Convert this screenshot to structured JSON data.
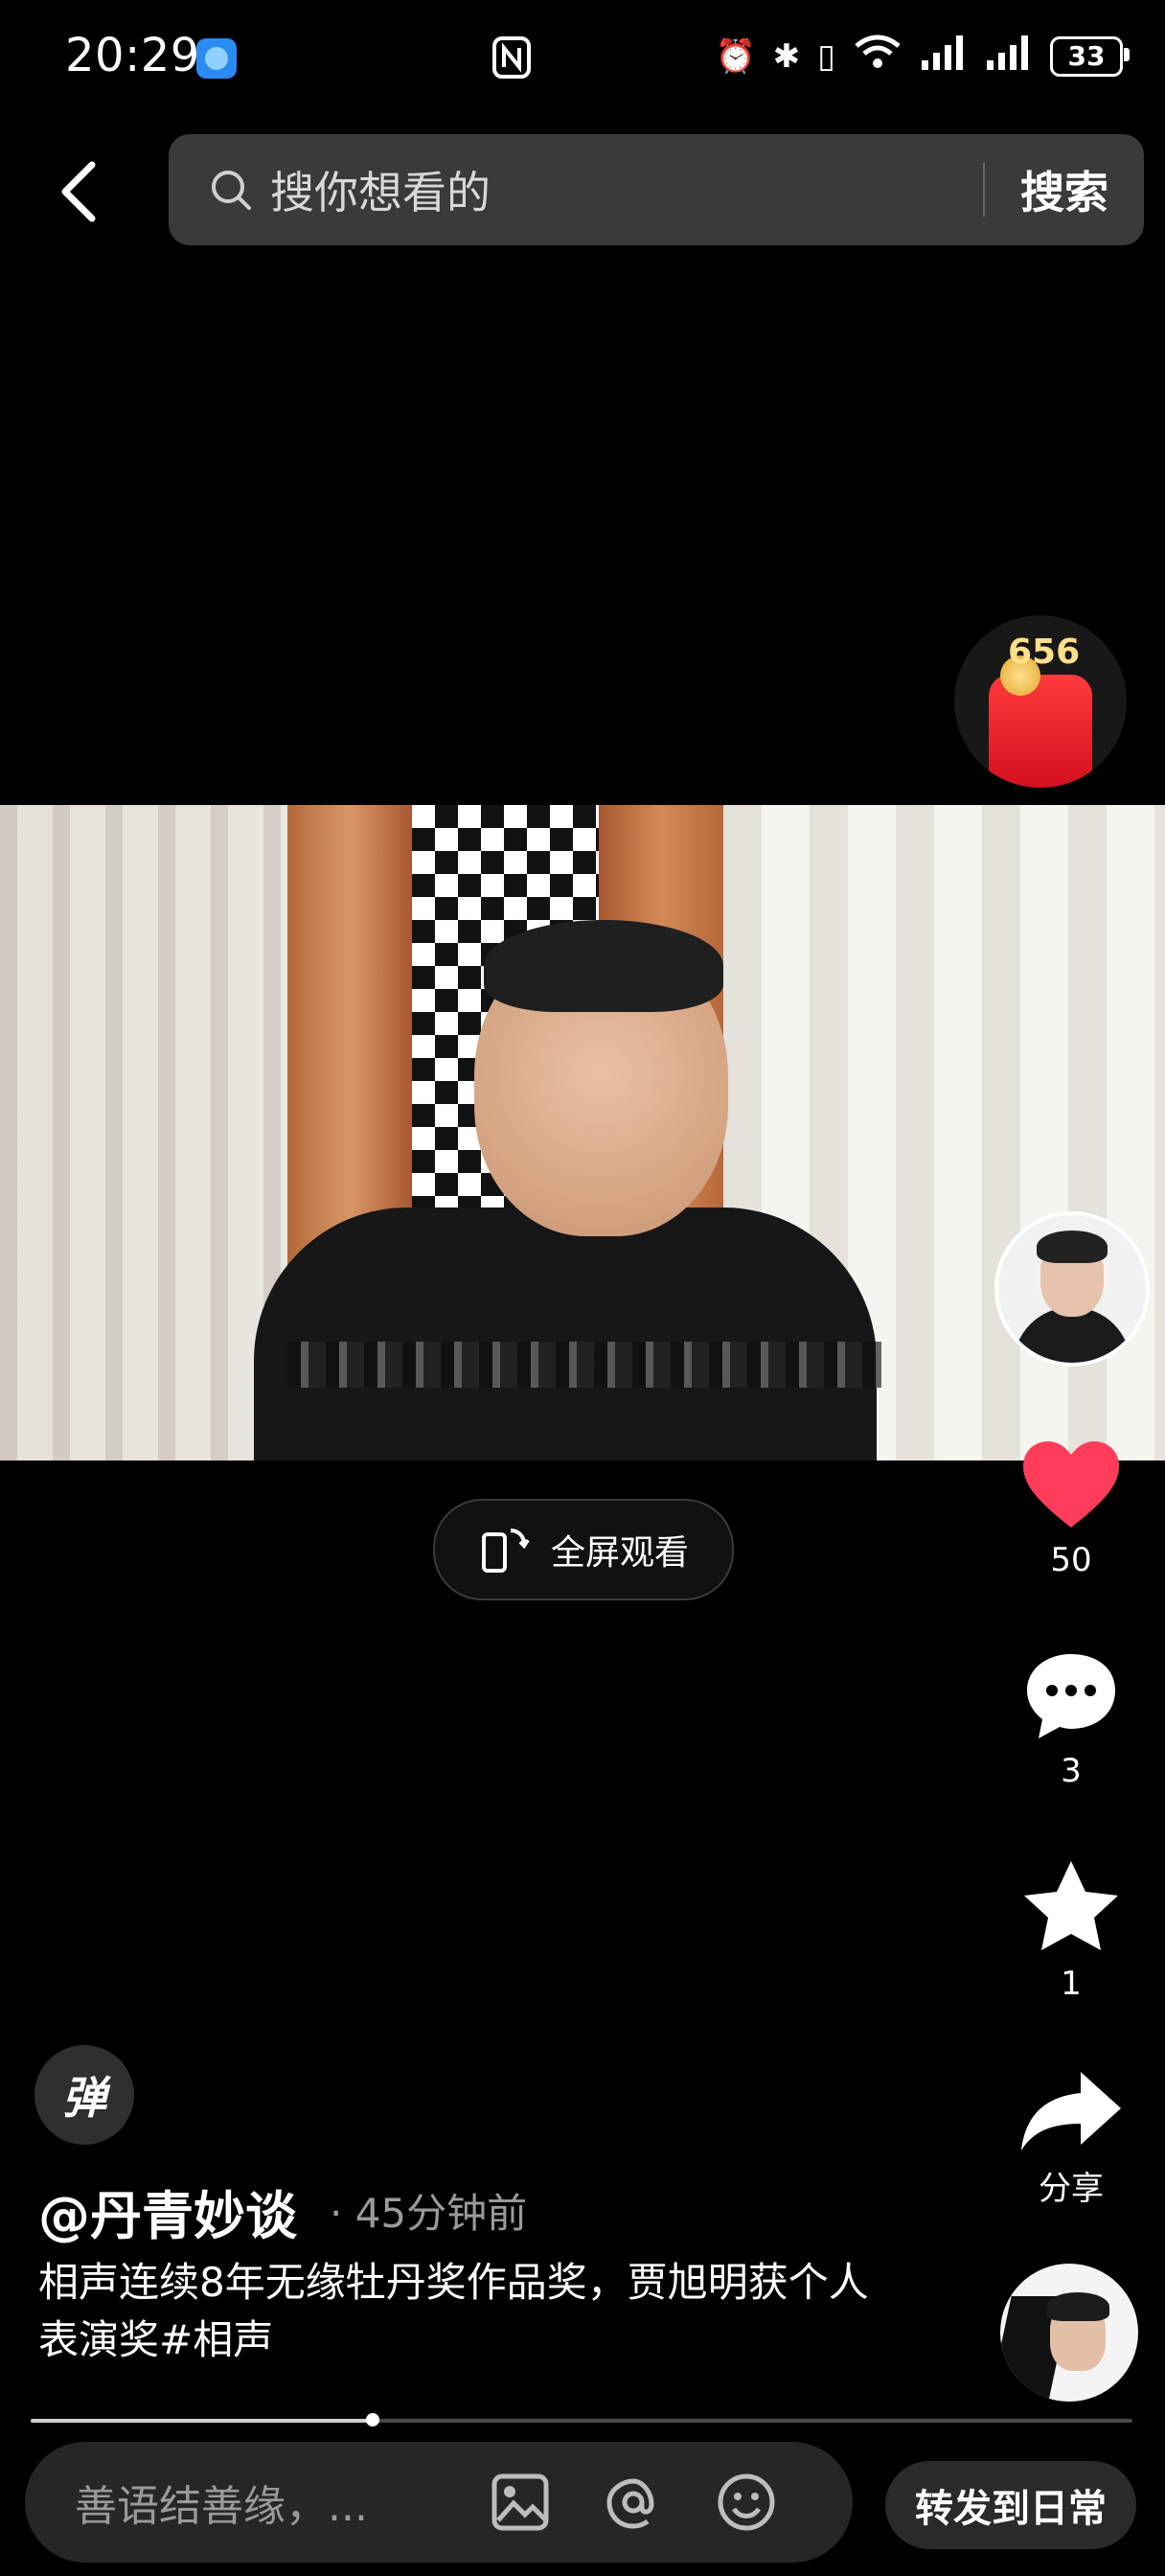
{
  "status_bar": {
    "time": "20:29",
    "battery": "33",
    "icons": [
      "nfc-icon",
      "alarm-icon",
      "bluetooth-icon",
      "vibrate-icon",
      "wifi-icon",
      "signal-icon",
      "signal-icon"
    ]
  },
  "search": {
    "placeholder": "搜你想看的",
    "button": "搜索"
  },
  "video": {
    "fullscreen_label": "全屏观看"
  },
  "reward": {
    "count": "656"
  },
  "actions": {
    "likes": "50",
    "comments": "3",
    "favorites": "1",
    "share_label": "分享"
  },
  "danmaku": {
    "label": "弹"
  },
  "post": {
    "author": "@丹青妙谈",
    "time": "· 45分钟前",
    "caption": "相声连续8年无缘牡丹奖作品奖，贾旭明获个人表演奖#相声"
  },
  "progress": {
    "fraction": 0.31
  },
  "comment_bar": {
    "placeholder": "善语结善缘，...",
    "share_daily": "转发到日常"
  },
  "colors": {
    "like": "#ff3d5a",
    "background": "#000000"
  }
}
